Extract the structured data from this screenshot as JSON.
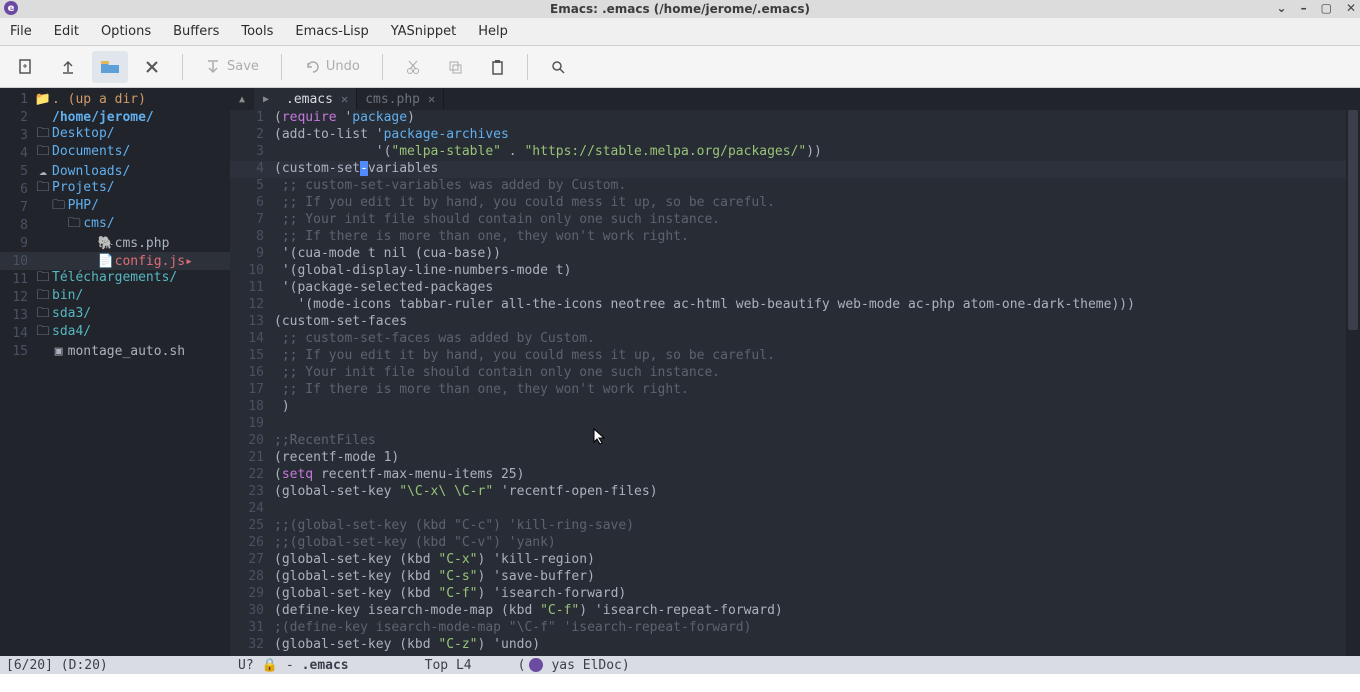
{
  "title": "Emacs: .emacs (/home/jerome/.emacs)",
  "menu": [
    "File",
    "Edit",
    "Options",
    "Buffers",
    "Tools",
    "Emacs-Lisp",
    "YASnippet",
    "Help"
  ],
  "toolbar": {
    "save": "Save",
    "undo": "Undo"
  },
  "neotree": [
    {
      "n": 1,
      "indent": 0,
      "icon": "up",
      "text": ". (up a dir)",
      "cls": "cur"
    },
    {
      "n": 2,
      "indent": 0,
      "icon": "none",
      "text": "/home/jerome/",
      "cls": "dir",
      "bold": true
    },
    {
      "n": 3,
      "indent": 0,
      "icon": "folder",
      "text": "Desktop/",
      "cls": "dir"
    },
    {
      "n": 4,
      "indent": 0,
      "icon": "folder",
      "text": "Documents/",
      "cls": "dir"
    },
    {
      "n": 5,
      "indent": 0,
      "icon": "cloud",
      "text": "Downloads/",
      "cls": "dir"
    },
    {
      "n": 6,
      "indent": 0,
      "icon": "folder",
      "text": "Projets/",
      "cls": "dir"
    },
    {
      "n": 7,
      "indent": 1,
      "icon": "folder",
      "text": "PHP/",
      "cls": "dir"
    },
    {
      "n": 8,
      "indent": 2,
      "icon": "folder",
      "text": "cms/",
      "cls": "dir"
    },
    {
      "n": 9,
      "indent": 4,
      "icon": "php",
      "text": "cms.php",
      "cls": "file"
    },
    {
      "n": 10,
      "indent": 4,
      "icon": "js",
      "text": "config.js",
      "cls": "sel",
      "sel": true,
      "arrow": true
    },
    {
      "n": 11,
      "indent": 0,
      "icon": "folder",
      "text": "Téléchargements/",
      "cls": "link"
    },
    {
      "n": 12,
      "indent": 0,
      "icon": "folder",
      "text": "bin/",
      "cls": "link"
    },
    {
      "n": 13,
      "indent": 0,
      "icon": "folder",
      "text": "sda3/",
      "cls": "link"
    },
    {
      "n": 14,
      "indent": 0,
      "icon": "folder",
      "text": "sda4/",
      "cls": "link"
    },
    {
      "n": 15,
      "indent": 1,
      "icon": "term",
      "text": "montage_auto.sh",
      "cls": "file"
    }
  ],
  "tabs": [
    {
      "label": ".emacs",
      "active": true
    },
    {
      "label": "cms.php",
      "active": false
    }
  ],
  "code": [
    {
      "n": 1,
      "seg": [
        [
          "(",
          "p"
        ],
        [
          "require",
          "kw"
        ],
        [
          " '",
          "p"
        ],
        [
          "package",
          "sym"
        ],
        [
          ")",
          "p"
        ]
      ]
    },
    {
      "n": 2,
      "seg": [
        [
          "(add-to-list '",
          "p"
        ],
        [
          "package-archives",
          "sym"
        ],
        [
          "",
          "p"
        ]
      ]
    },
    {
      "n": 3,
      "seg": [
        [
          "             '(",
          "p"
        ],
        [
          "\"melpa-stable\"",
          "str"
        ],
        [
          " . ",
          "p"
        ],
        [
          "\"https://stable.melpa.org/packages/\"",
          "str"
        ],
        [
          "))",
          "p"
        ]
      ]
    },
    {
      "n": 4,
      "hl": true,
      "seg": [
        [
          "(custom-set",
          "p"
        ],
        [
          "-",
          "cursor"
        ],
        [
          "variables",
          "p"
        ]
      ]
    },
    {
      "n": 5,
      "seg": [
        [
          " ;; custom-set-variables was added by Custom.",
          "cmt"
        ]
      ]
    },
    {
      "n": 6,
      "seg": [
        [
          " ;; If you edit it by hand, you could mess it up, so be careful.",
          "cmt"
        ]
      ]
    },
    {
      "n": 7,
      "seg": [
        [
          " ;; Your init file should contain only one such instance.",
          "cmt"
        ]
      ]
    },
    {
      "n": 8,
      "seg": [
        [
          " ;; If there is more than one, they won't work right.",
          "cmt"
        ]
      ]
    },
    {
      "n": 9,
      "seg": [
        [
          " '(cua-mode t nil (cua-base))",
          "p"
        ]
      ]
    },
    {
      "n": 10,
      "seg": [
        [
          " '(global-display-line-numbers-mode t)",
          "p"
        ]
      ]
    },
    {
      "n": 11,
      "seg": [
        [
          " '(package-selected-packages",
          "p"
        ]
      ]
    },
    {
      "n": 12,
      "seg": [
        [
          "   '(mode-icons tabbar-ruler all-the-icons neotree ac-html web-beautify web-mode ac-php atom-one-dark-theme)))",
          "p"
        ]
      ]
    },
    {
      "n": 13,
      "seg": [
        [
          "(custom-set-faces",
          "p"
        ]
      ]
    },
    {
      "n": 14,
      "seg": [
        [
          " ;; custom-set-faces was added by Custom.",
          "cmt"
        ]
      ]
    },
    {
      "n": 15,
      "seg": [
        [
          " ;; If you edit it by hand, you could mess it up, so be careful.",
          "cmt"
        ]
      ]
    },
    {
      "n": 16,
      "seg": [
        [
          " ;; Your init file should contain only one such instance.",
          "cmt"
        ]
      ]
    },
    {
      "n": 17,
      "seg": [
        [
          " ;; If there is more than one, they won't work right.",
          "cmt"
        ]
      ]
    },
    {
      "n": 18,
      "seg": [
        [
          " )",
          "p"
        ]
      ]
    },
    {
      "n": 19,
      "seg": [
        [
          "",
          "p"
        ]
      ]
    },
    {
      "n": 20,
      "seg": [
        [
          ";;RecentFiles",
          "cmt"
        ]
      ]
    },
    {
      "n": 21,
      "seg": [
        [
          "(recentf-mode 1)",
          "p"
        ]
      ]
    },
    {
      "n": 22,
      "seg": [
        [
          "(",
          "p"
        ],
        [
          "setq",
          "kw"
        ],
        [
          " recentf-max-menu-items 25)",
          "p"
        ]
      ]
    },
    {
      "n": 23,
      "seg": [
        [
          "(global-set-key ",
          "p"
        ],
        [
          "\"\\C-x\\ \\C-r\"",
          "str"
        ],
        [
          " 'recentf-open-files)",
          "p"
        ]
      ]
    },
    {
      "n": 24,
      "seg": [
        [
          "",
          "p"
        ]
      ]
    },
    {
      "n": 25,
      "seg": [
        [
          ";;(global-set-key (kbd \"C-c\") 'kill-ring-save)",
          "cmt"
        ]
      ]
    },
    {
      "n": 26,
      "seg": [
        [
          ";;(global-set-key (kbd \"C-v\") 'yank)",
          "cmt"
        ]
      ]
    },
    {
      "n": 27,
      "seg": [
        [
          "(global-set-key (kbd ",
          "p"
        ],
        [
          "\"C-x\"",
          "str"
        ],
        [
          ") 'kill-region)",
          "p"
        ]
      ]
    },
    {
      "n": 28,
      "seg": [
        [
          "(global-set-key (kbd ",
          "p"
        ],
        [
          "\"C-s\"",
          "str"
        ],
        [
          ") 'save-buffer)",
          "p"
        ]
      ]
    },
    {
      "n": 29,
      "seg": [
        [
          "(global-set-key (kbd ",
          "p"
        ],
        [
          "\"C-f\"",
          "str"
        ],
        [
          ") 'isearch-forward)",
          "p"
        ]
      ]
    },
    {
      "n": 30,
      "seg": [
        [
          "(define-key isearch-mode-map (kbd ",
          "p"
        ],
        [
          "\"C-f\"",
          "str"
        ],
        [
          ") 'isearch-repeat-forward)",
          "p"
        ]
      ]
    },
    {
      "n": 31,
      "seg": [
        [
          ";(define-key isearch-mode-map \"\\C-f\" 'isearch-repeat-forward)",
          "cmt"
        ]
      ]
    },
    {
      "n": 32,
      "seg": [
        [
          "(global-set-key (kbd ",
          "p"
        ],
        [
          "\"C-z\"",
          "str"
        ],
        [
          ") 'undo)",
          "p"
        ]
      ]
    }
  ],
  "modeline_left": "[6/20]  (D:20)",
  "modeline_right": {
    "enc": "U?",
    "lock": "🔒",
    "dash": "-",
    "buf": ".emacs",
    "pos": "Top L4",
    "extra": "yas ElDoc)"
  }
}
